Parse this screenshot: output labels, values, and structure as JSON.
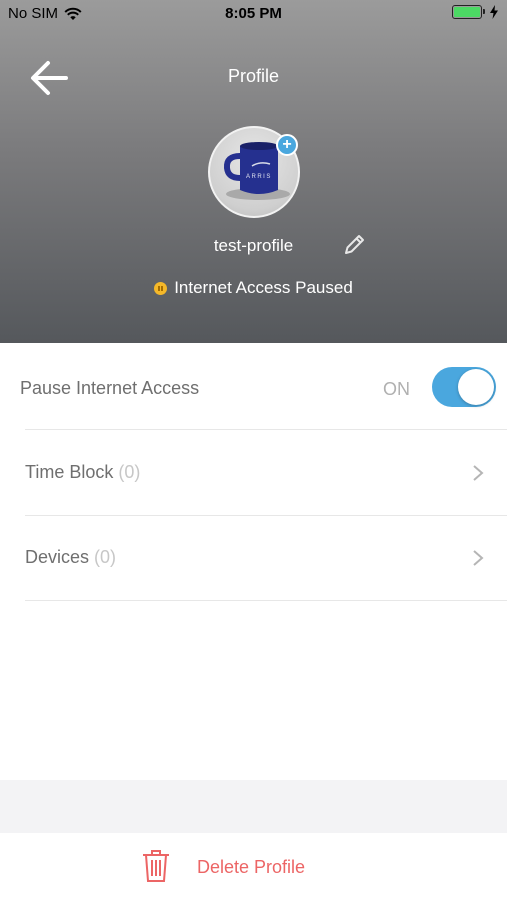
{
  "status_bar": {
    "carrier": "No SIM",
    "time": "8:05 PM"
  },
  "header": {
    "title": "Profile",
    "profile_name": "test-profile",
    "status": "Internet Access Paused"
  },
  "settings": {
    "pause": {
      "label": "Pause Internet Access",
      "state": "ON",
      "enabled": true
    },
    "time_block": {
      "label": "Time Block",
      "count": "(0)"
    },
    "devices": {
      "label": "Devices",
      "count": "(0)"
    }
  },
  "actions": {
    "delete_label": "Delete Profile"
  },
  "colors": {
    "accent": "#4aa7de",
    "danger": "#ec6565",
    "status_paused": "#f5b829"
  },
  "icons": [
    "back-arrow-icon",
    "wifi-icon",
    "battery-icon",
    "charging-icon",
    "add-photo-icon",
    "pencil-icon",
    "chevron-right-icon",
    "trash-icon",
    "pause-status-icon"
  ]
}
